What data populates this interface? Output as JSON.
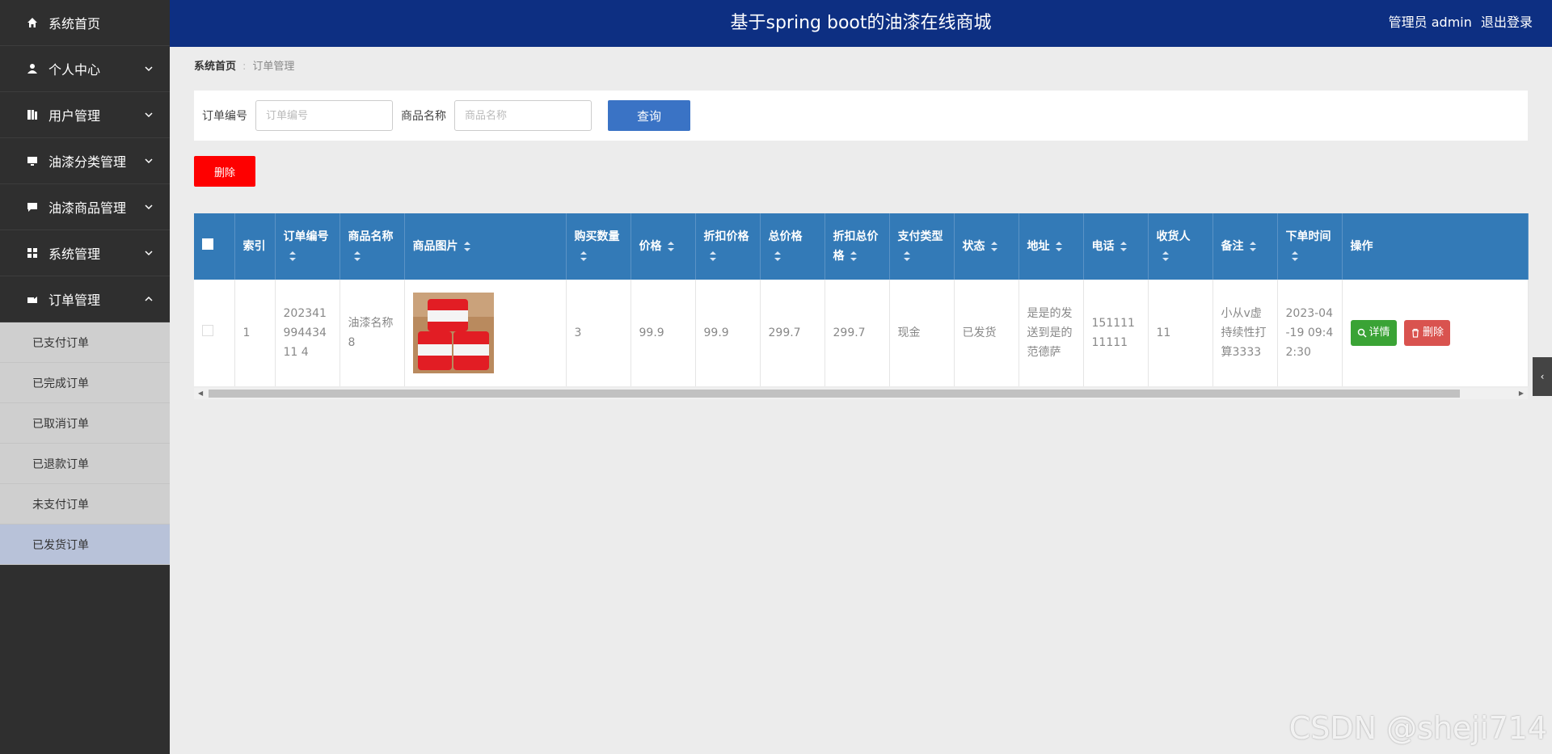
{
  "header": {
    "title": "基于spring boot的油漆在线商城",
    "user": "管理员 admin",
    "logout": "退出登录"
  },
  "sidebar": {
    "items": [
      {
        "label": "系统首页",
        "icon": "home-icon"
      },
      {
        "label": "个人中心",
        "icon": "user-icon"
      },
      {
        "label": "用户管理",
        "icon": "book-icon"
      },
      {
        "label": "油漆分类管理",
        "icon": "monitor-icon"
      },
      {
        "label": "油漆商品管理",
        "icon": "chat-icon"
      },
      {
        "label": "系统管理",
        "icon": "grid-icon"
      },
      {
        "label": "订单管理",
        "icon": "cart-icon"
      }
    ],
    "order_sub": [
      "已支付订单",
      "已完成订单",
      "已取消订单",
      "已退款订单",
      "未支付订单",
      "已发货订单"
    ]
  },
  "breadcrumb": {
    "home": "系统首页",
    "sep": ":",
    "current": "订单管理"
  },
  "search": {
    "order_no_label": "订单编号",
    "order_no_placeholder": "订单编号",
    "product_label": "商品名称",
    "product_placeholder": "商品名称",
    "query_btn": "查询"
  },
  "delete_btn": "删除",
  "table": {
    "headers": [
      "索引",
      "订单编号",
      "商品名称",
      "商品图片",
      "购买数量",
      "价格",
      "折扣价格",
      "总价格",
      "折扣总价格",
      "支付类型",
      "状态",
      "地址",
      "电话",
      "收货人",
      "备注",
      "下单时间",
      "操作"
    ],
    "row": {
      "index": "1",
      "order_no": "20234199443411 4",
      "product": "油漆名称8",
      "qty": "3",
      "price": "99.9",
      "discount_price": "99.9",
      "total": "299.7",
      "discount_total": "299.7",
      "pay_type": "现金",
      "status": "已发货",
      "address": "是是的发送到是的范德萨",
      "phone": "15111111111",
      "receiver": "11",
      "remark": "小从v虚持续性打算3333",
      "time": "2023-04-19 09:42:30",
      "detail_btn": "详情",
      "delete_btn": "删除"
    }
  },
  "watermark": "CSDN @sheji714",
  "colors": {
    "header": "#0d2f82",
    "table_head": "#337ab7",
    "delete": "#fe0000",
    "detail": "#3aa335"
  }
}
